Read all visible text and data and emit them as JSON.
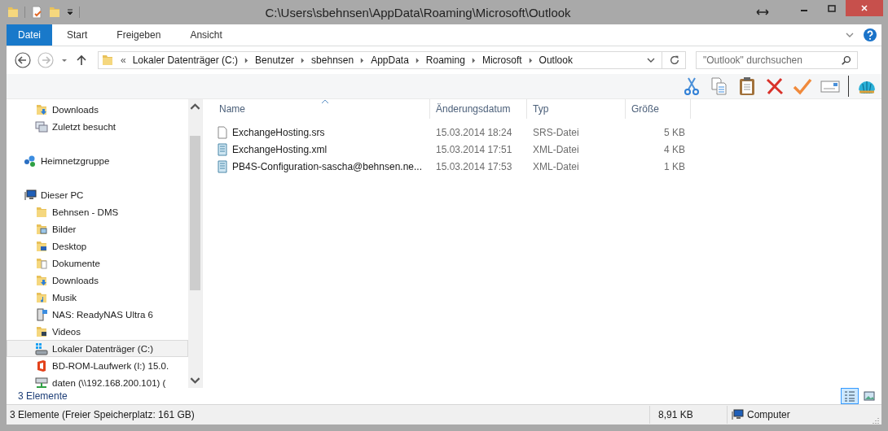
{
  "window": {
    "title": "C:\\Users\\sbehnsen\\AppData\\Roaming\\Microsoft\\Outlook"
  },
  "ribbon_tabs": [
    {
      "label": "Datei",
      "kind": "file"
    },
    {
      "label": "Start",
      "kind": "tab"
    },
    {
      "label": "Freigeben",
      "kind": "tab"
    },
    {
      "label": "Ansicht",
      "kind": "tab"
    }
  ],
  "address_bar": {
    "overflow": "«",
    "crumbs": [
      "Lokaler Datenträger (C:)",
      "Benutzer",
      "sbehnsen",
      "AppData",
      "Roaming",
      "Microsoft",
      "Outlook"
    ]
  },
  "search": {
    "placeholder": "\"Outlook\" durchsuchen"
  },
  "navigation": [
    {
      "children": [
        {
          "label": "Downloads",
          "kind": "folder-download",
          "selected": false
        },
        {
          "label": "Zuletzt besucht",
          "kind": "recent",
          "selected": false
        }
      ]
    },
    {
      "label": "Heimnetzgruppe",
      "kind": "homegroup",
      "selected": false
    },
    {
      "label": "Dieser PC",
      "kind": "pc",
      "selected": false,
      "children": [
        {
          "label": "Behnsen - DMS",
          "kind": "folder",
          "selected": false
        },
        {
          "label": "Bilder",
          "kind": "folder-pictures",
          "selected": false
        },
        {
          "label": "Desktop",
          "kind": "folder-desktop",
          "selected": false
        },
        {
          "label": "Dokumente",
          "kind": "folder-documents",
          "selected": false
        },
        {
          "label": "Downloads",
          "kind": "folder-download",
          "selected": false
        },
        {
          "label": "Musik",
          "kind": "folder-music",
          "selected": false
        },
        {
          "label": "NAS: ReadyNAS Ultra 6",
          "kind": "nas",
          "selected": false
        },
        {
          "label": "Videos",
          "kind": "folder-videos",
          "selected": false
        },
        {
          "label": "Lokaler Datenträger (C:)",
          "kind": "drive",
          "selected": true
        },
        {
          "label": "BD-ROM-Laufwerk (I:) 15.0.",
          "kind": "office",
          "selected": false
        },
        {
          "label": "daten (\\\\192.168.200.101) (",
          "kind": "network-drive",
          "selected": false
        }
      ]
    }
  ],
  "file_list": {
    "columns": [
      {
        "label": "Name",
        "sorted": true
      },
      {
        "label": "Änderungsdatum",
        "sorted": false
      },
      {
        "label": "Typ",
        "sorted": false
      },
      {
        "label": "Größe",
        "sorted": false
      }
    ],
    "rows": [
      {
        "name": "ExchangeHosting.srs",
        "kind": "file",
        "date": "15.03.2014 18:24",
        "type": "SRS-Datei",
        "size": "5 KB"
      },
      {
        "name": "ExchangeHosting.xml",
        "kind": "xml",
        "date": "15.03.2014 17:51",
        "type": "XML-Datei",
        "size": "4 KB"
      },
      {
        "name": "PB4S-Configuration-sascha@behnsen.ne...",
        "kind": "xml",
        "date": "15.03.2014 17:53",
        "type": "XML-Datei",
        "size": "1 KB"
      }
    ]
  },
  "item_count": "3 Elemente",
  "view_buttons": [
    {
      "kind": "details",
      "selected": true
    },
    {
      "kind": "large-icons",
      "selected": false
    }
  ],
  "status_bar": {
    "summary": "3 Elemente (Freier Speicherplatz: 161 GB)",
    "size": "8,91 KB",
    "location": "Computer"
  }
}
